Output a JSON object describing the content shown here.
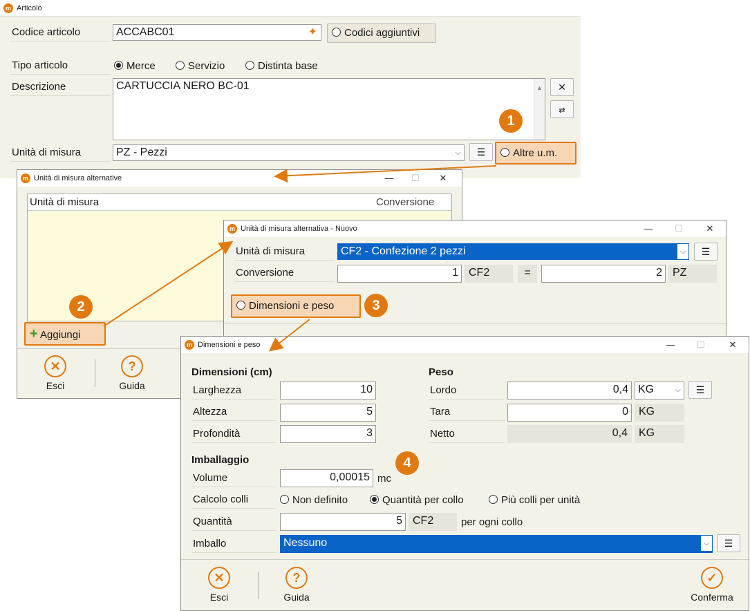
{
  "articolo": {
    "title": "Articolo",
    "codice_label": "Codice articolo",
    "codice_value": "ACCABC01",
    "codici_aggiuntivi": "Codici aggiuntivi",
    "tipo_label": "Tipo articolo",
    "tipo_options": [
      "Merce",
      "Servizio",
      "Distinta base"
    ],
    "tipo_selected": "Merce",
    "descrizione_label": "Descrizione",
    "descrizione_value": "CARTUCCIA NERO BC-01",
    "um_label": "Unità di misura",
    "um_value": "PZ - Pezzi",
    "altre_um": "Altre u.m."
  },
  "um_alternative": {
    "title": "Unità di misura alternative",
    "col_um": "Unità di misura",
    "col_conv": "Conversione",
    "aggiungi": "Aggiungi",
    "esci": "Esci",
    "guida": "Guida"
  },
  "um_nuovo": {
    "title": "Unità di misura alternativa - Nuovo",
    "um_label": "Unità di misura",
    "um_value": "CF2 - Confezione 2 pezzi",
    "conv_label": "Conversione",
    "conv_left": "1",
    "conv_left_unit": "CF2",
    "equals": "=",
    "conv_right": "2",
    "conv_right_unit": "PZ",
    "dim_peso_btn": "Dimensioni e peso"
  },
  "dim_peso": {
    "title": "Dimensioni e peso",
    "dim_header": "Dimensioni (cm)",
    "larghezza_label": "Larghezza",
    "larghezza": "10",
    "altezza_label": "Altezza",
    "altezza": "5",
    "profondita_label": "Profondità",
    "profondita": "3",
    "peso_header": "Peso",
    "lordo_label": "Lordo",
    "lordo": "0,4",
    "lordo_unit": "KG",
    "tara_label": "Tara",
    "tara": "0",
    "tara_unit": "KG",
    "netto_label": "Netto",
    "netto": "0,4",
    "netto_unit": "KG",
    "imballaggio_header": "Imballaggio",
    "volume_label": "Volume",
    "volume": "0,00015",
    "volume_unit": "mc",
    "calcolo_label": "Calcolo colli",
    "calcolo_options": [
      "Non definito",
      "Quantità per collo",
      "Più colli per unità"
    ],
    "calcolo_selected": "Quantità per collo",
    "quantita_label": "Quantità",
    "quantita": "5",
    "quantita_unit": "CF2",
    "per_collo": "per ogni collo",
    "imballo_label": "Imballo",
    "imballo": "Nessuno",
    "esci": "Esci",
    "guida": "Guida",
    "conferma": "Conferma"
  },
  "badges": [
    "1",
    "2",
    "3",
    "4"
  ],
  "colors": {
    "accent": "#e07a10",
    "selection": "#0a64c8",
    "window_bg": "#f3f2e8"
  }
}
